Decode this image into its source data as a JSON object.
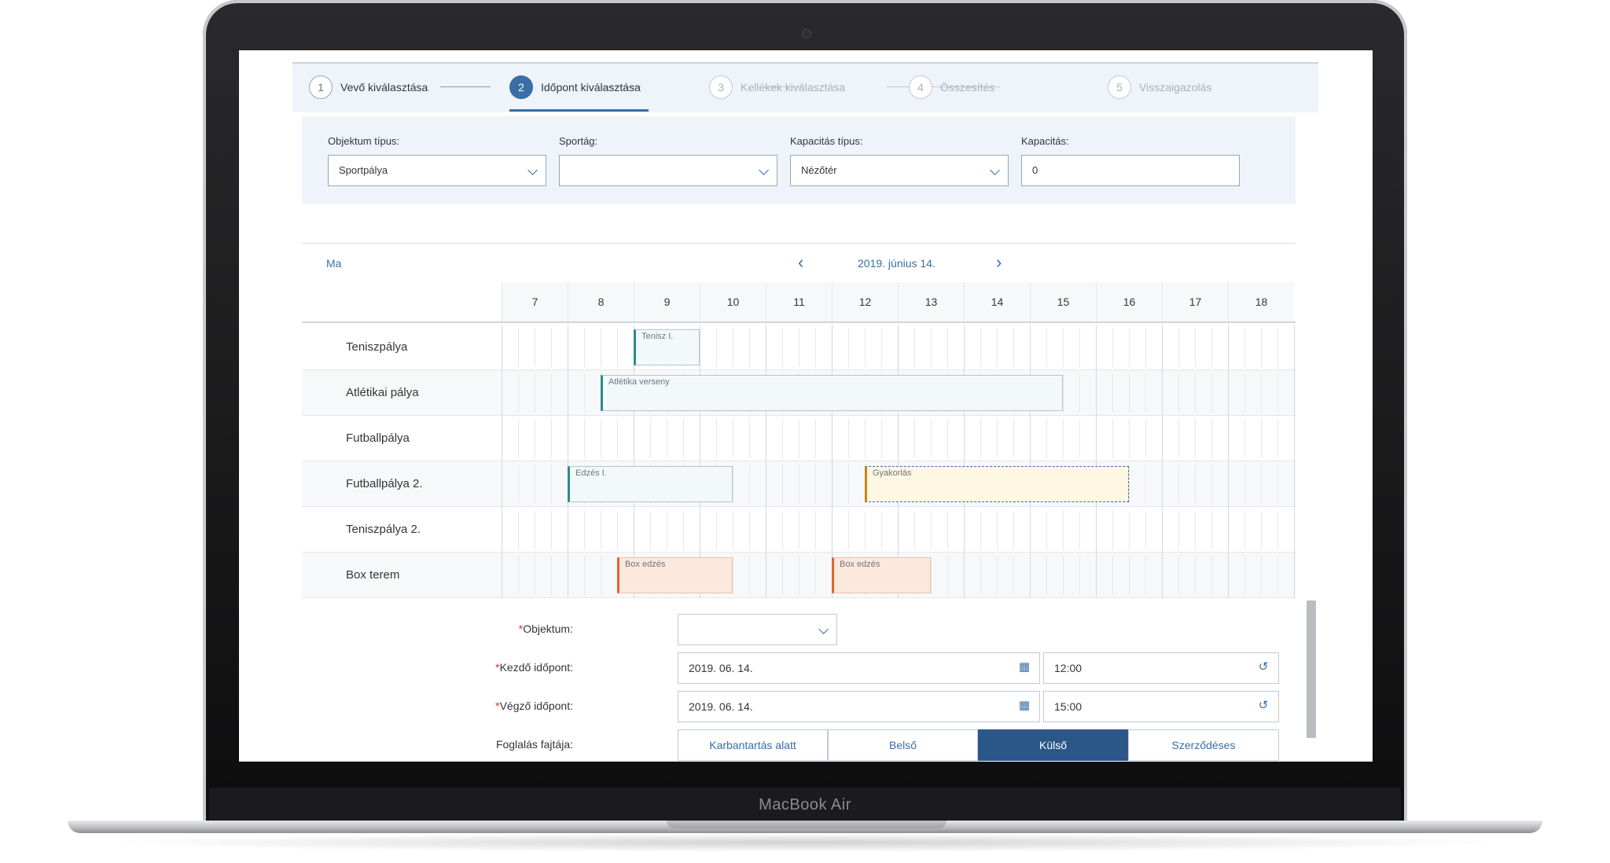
{
  "device": {
    "brand_label": "MacBook Air"
  },
  "wizard": {
    "steps": [
      {
        "number": "1",
        "label": "Vevő kiválasztása"
      },
      {
        "number": "2",
        "label": "Időpont kiválasztása"
      },
      {
        "number": "3",
        "label": "Kellékek kiválasztása"
      },
      {
        "number": "4",
        "label": "Összesítés"
      },
      {
        "number": "5",
        "label": "Visszaigazolás"
      }
    ],
    "active_step": 2
  },
  "filters": {
    "object_type": {
      "label": "Objektum típus:",
      "value": "Sportpálya"
    },
    "sport": {
      "label": "Sportág:",
      "value": ""
    },
    "capacity_type": {
      "label": "Kapacitás típus:",
      "value": "Nézőtér"
    },
    "capacity": {
      "label": "Kapacitás:",
      "value": "0"
    }
  },
  "calendar": {
    "today_label": "Ma",
    "date_label": "2019. június 14.",
    "hours": [
      "7",
      "8",
      "9",
      "10",
      "11",
      "12",
      "13",
      "14",
      "15",
      "16",
      "17",
      "18"
    ],
    "rows": [
      {
        "label": "Teniszpálya",
        "appointments": [
          {
            "title": "Tenisz I.",
            "start": 9.0,
            "end": 10.0,
            "style": "teal"
          }
        ]
      },
      {
        "label": "Atlétikai pálya",
        "appointments": [
          {
            "title": "Atlétika verseny",
            "start": 8.5,
            "end": 15.5,
            "style": "teal"
          }
        ]
      },
      {
        "label": "Futballpálya",
        "appointments": []
      },
      {
        "label": "Futballpálya 2.",
        "appointments": [
          {
            "title": "Edzés I.",
            "start": 8.0,
            "end": 10.5,
            "style": "teal"
          },
          {
            "title": "Gyakorlás",
            "start": 12.5,
            "end": 16.5,
            "style": "yellow"
          }
        ]
      },
      {
        "label": "Teniszpálya 2.",
        "appointments": []
      },
      {
        "label": "Box terem",
        "appointments": [
          {
            "title": "Box edzés",
            "start": 8.75,
            "end": 10.5,
            "style": "orange"
          },
          {
            "title": "Box edzés",
            "start": 12.0,
            "end": 13.5,
            "style": "orange"
          }
        ]
      }
    ]
  },
  "form": {
    "object": {
      "label": "Objektum:",
      "value": ""
    },
    "start": {
      "label": "Kezdő időpont:",
      "date": "2019. 06. 14.",
      "time": "12:00"
    },
    "end": {
      "label": "Végző időpont:",
      "date": "2019. 06. 14.",
      "time": "15:00"
    },
    "booking_type": {
      "label": "Foglalás fajtája:",
      "options": [
        "Karbantartás alatt",
        "Belső",
        "Külső",
        "Szerződéses"
      ],
      "selected": "Külső"
    }
  },
  "colors": {
    "accent": "#3a6ea5",
    "selected_segment": "#2b5788",
    "teal": "#2a8a8e",
    "yellow": "#c38a13",
    "orange": "#e3642a"
  },
  "icons": {
    "calendar": "calendar-icon",
    "time": "clock-icon",
    "dropdown": "chevron-down-icon"
  }
}
